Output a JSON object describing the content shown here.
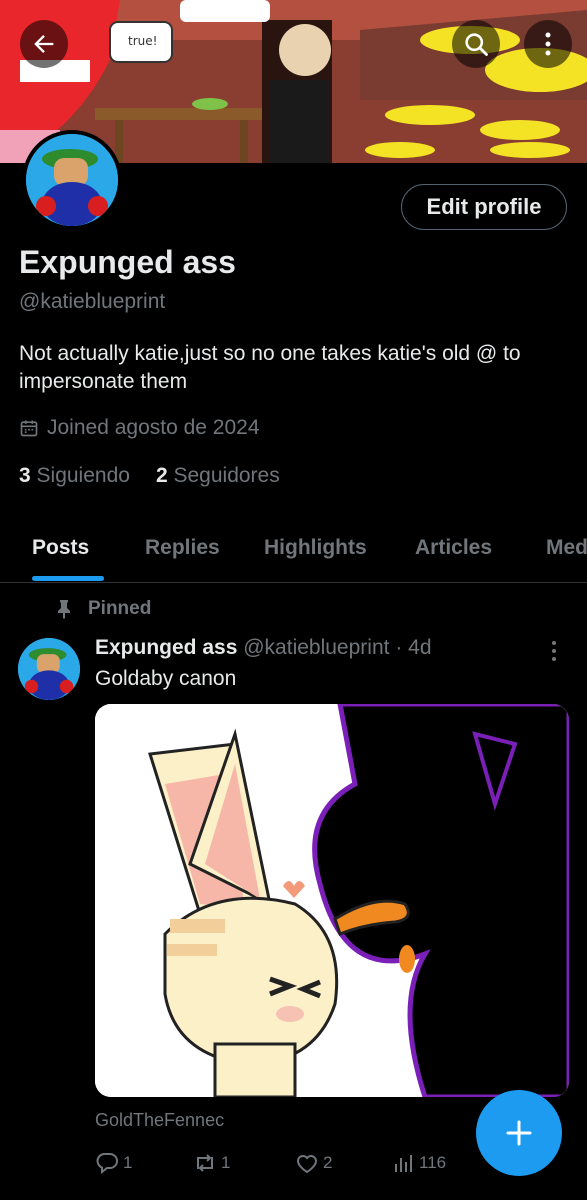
{
  "banner": {
    "speech_bubble": "true!"
  },
  "profile": {
    "display_name": "Expunged ass",
    "handle": "@katieblueprint",
    "bio": "Not actually katie,just so no one takes katie's old @ to impersonate them",
    "joined": "Joined agosto de 2024",
    "following_count": "3",
    "following_label": "Siguiendo",
    "followers_count": "2",
    "followers_label": "Seguidores",
    "edit_label": "Edit profile"
  },
  "tabs": [
    {
      "label": "Posts",
      "active": true
    },
    {
      "label": "Replies"
    },
    {
      "label": "Highlights"
    },
    {
      "label": "Articles"
    },
    {
      "label": "Med"
    }
  ],
  "post": {
    "pinned_label": "Pinned",
    "author": "Expunged ass",
    "handle": "@katieblueprint",
    "time": "· 4d",
    "text": "Goldaby canon",
    "image_caption": "GoldTheFennec",
    "replies": "1",
    "reposts": "1",
    "likes": "2",
    "views": "116"
  },
  "colors": {
    "accent": "#1d9bf0",
    "muted": "#71767b",
    "text": "#e7e9ea",
    "divider": "#2f3336"
  },
  "icons": [
    "back-arrow-icon",
    "search-icon",
    "more-vertical-icon",
    "calendar-icon",
    "pin-icon",
    "reply-icon",
    "repost-icon",
    "like-icon",
    "views-icon",
    "compose-plus-icon"
  ]
}
